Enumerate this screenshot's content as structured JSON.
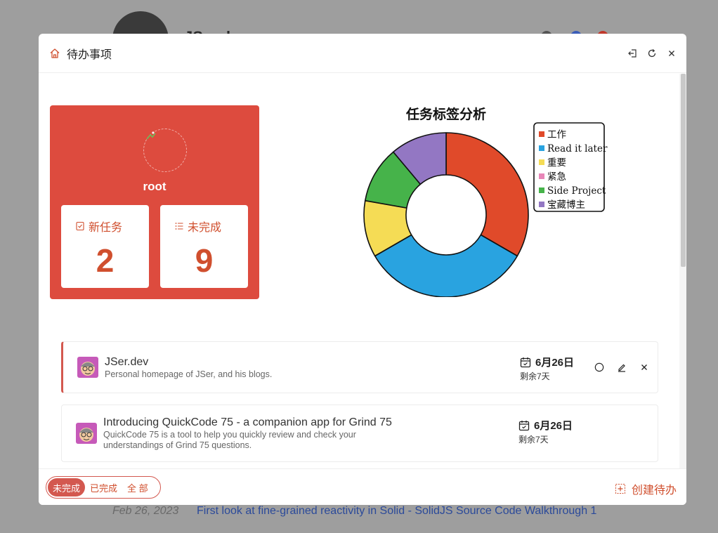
{
  "modal": {
    "title": "待办事项"
  },
  "user": {
    "name": "root"
  },
  "stats": {
    "new_label": "新任务",
    "new_value": "2",
    "pending_label": "未完成",
    "pending_value": "9"
  },
  "chart_data": {
    "type": "pie",
    "title": "任务标签分析",
    "categories": [
      "工作",
      "Read it later",
      "重要",
      "紧急",
      "Side Project",
      "宝藏博主"
    ],
    "values": [
      3,
      3,
      1,
      0,
      1,
      1
    ],
    "colors": [
      "#e04a2a",
      "#29a3e0",
      "#f5dc55",
      "#e886b8",
      "#46b34a",
      "#9377c3"
    ],
    "legend_position": "top-right"
  },
  "todos": [
    {
      "title": "JSer.dev",
      "description": "Personal homepage of JSer, and his blogs.",
      "date": "6月26日",
      "remaining": "剩余7天"
    },
    {
      "title": "Introducing QuickCode 75 - a companion app for Grind 75",
      "description": "QuickCode 75 is a tool to help you quickly review and check your understandings of Grind 75 questions.",
      "date": "6月26日",
      "remaining": "剩余7天"
    }
  ],
  "footer": {
    "filters": [
      "未完成",
      "已完成",
      "全 部"
    ],
    "create_label": "创建待办"
  },
  "background": {
    "name": "JSer.dev",
    "footer_date": "Feb 26, 2023",
    "footer_link": "First look at fine-grained reactivity in Solid - SolidJS Source Code Walkthrough 1"
  }
}
